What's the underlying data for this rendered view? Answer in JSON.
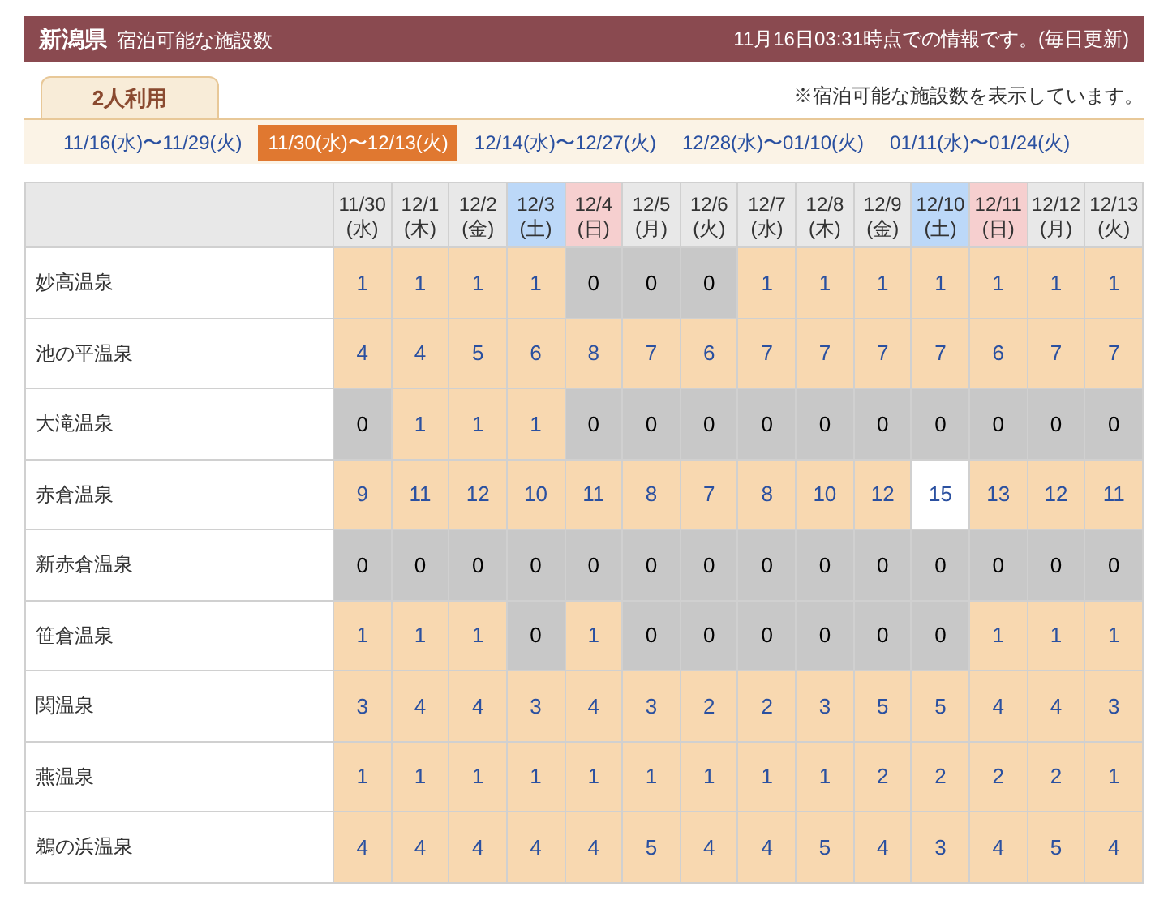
{
  "header": {
    "prefecture": "新潟県",
    "subtitle": "宿泊可能な施設数",
    "updated": "11月16日03:31時点での情報です。(毎日更新)"
  },
  "tabs": [
    {
      "label": "2人利用",
      "selected": true
    }
  ],
  "note": "※宿泊可能な施設数を表示しています。",
  "ranges": [
    {
      "label": "11/16(水)〜11/29(火)",
      "selected": false
    },
    {
      "label": "11/30(水)〜12/13(火)",
      "selected": true
    },
    {
      "label": "12/14(水)〜12/27(火)",
      "selected": false
    },
    {
      "label": "12/28(水)〜01/10(火)",
      "selected": false
    },
    {
      "label": "01/11(水)〜01/24(火)",
      "selected": false
    }
  ],
  "table": {
    "columns": [
      {
        "date": "11/30",
        "weekday": "(水)",
        "kind": "weekday"
      },
      {
        "date": "12/1",
        "weekday": "(木)",
        "kind": "weekday"
      },
      {
        "date": "12/2",
        "weekday": "(金)",
        "kind": "weekday"
      },
      {
        "date": "12/3",
        "weekday": "(土)",
        "kind": "saturday"
      },
      {
        "date": "12/4",
        "weekday": "(日)",
        "kind": "sunday"
      },
      {
        "date": "12/5",
        "weekday": "(月)",
        "kind": "weekday"
      },
      {
        "date": "12/6",
        "weekday": "(火)",
        "kind": "weekday"
      },
      {
        "date": "12/7",
        "weekday": "(水)",
        "kind": "weekday"
      },
      {
        "date": "12/8",
        "weekday": "(木)",
        "kind": "weekday"
      },
      {
        "date": "12/9",
        "weekday": "(金)",
        "kind": "weekday"
      },
      {
        "date": "12/10",
        "weekday": "(土)",
        "kind": "saturday"
      },
      {
        "date": "12/11",
        "weekday": "(日)",
        "kind": "sunday"
      },
      {
        "date": "12/12",
        "weekday": "(月)",
        "kind": "weekday"
      },
      {
        "date": "12/13",
        "weekday": "(火)",
        "kind": "weekday"
      }
    ],
    "rows": [
      {
        "name": "妙高温泉",
        "cells": [
          "1",
          "1",
          "1",
          "1",
          "0",
          "0",
          "0",
          "1",
          "1",
          "1",
          "1",
          "1",
          "1",
          "1"
        ]
      },
      {
        "name": "池の平温泉",
        "cells": [
          "4",
          "4",
          "5",
          "6",
          "8",
          "7",
          "6",
          "7",
          "7",
          "7",
          "7",
          "6",
          "7",
          "7"
        ]
      },
      {
        "name": "大滝温泉",
        "cells": [
          "0",
          "1",
          "1",
          "1",
          "0",
          "0",
          "0",
          "0",
          "0",
          "0",
          "0",
          "0",
          "0",
          "0"
        ]
      },
      {
        "name": "赤倉温泉",
        "cells": [
          {
            "value": "9",
            "selected": false
          },
          {
            "value": "11",
            "selected": false
          },
          {
            "value": "12",
            "selected": false
          },
          {
            "value": "10",
            "selected": false
          },
          {
            "value": "11",
            "selected": false
          },
          {
            "value": "8",
            "selected": false
          },
          {
            "value": "7",
            "selected": false
          },
          {
            "value": "8",
            "selected": false
          },
          {
            "value": "10",
            "selected": false
          },
          {
            "value": "12",
            "selected": false
          },
          {
            "value": "15",
            "selected": true
          },
          {
            "value": "13",
            "selected": false
          },
          {
            "value": "12",
            "selected": false
          },
          {
            "value": "11",
            "selected": false
          }
        ]
      },
      {
        "name": "新赤倉温泉",
        "cells": [
          "0",
          "0",
          "0",
          "0",
          "0",
          "0",
          "0",
          "0",
          "0",
          "0",
          "0",
          "0",
          "0",
          "0"
        ]
      },
      {
        "name": "笹倉温泉",
        "cells": [
          "1",
          "1",
          "1",
          "0",
          "1",
          "0",
          "0",
          "0",
          "0",
          "0",
          "0",
          "1",
          "1",
          "1"
        ]
      },
      {
        "name": "関温泉",
        "cells": [
          "3",
          "4",
          "4",
          "3",
          "4",
          "3",
          "2",
          "2",
          "3",
          "5",
          "5",
          "4",
          "4",
          "3"
        ]
      },
      {
        "name": "燕温泉",
        "cells": [
          "1",
          "1",
          "1",
          "1",
          "1",
          "1",
          "1",
          "1",
          "1",
          "2",
          "2",
          "2",
          "2",
          "1"
        ]
      },
      {
        "name": "鵜の浜温泉",
        "cells": [
          "4",
          "4",
          "4",
          "4",
          "4",
          "5",
          "4",
          "4",
          "5",
          "4",
          "3",
          "4",
          "5",
          "4"
        ]
      }
    ]
  }
}
